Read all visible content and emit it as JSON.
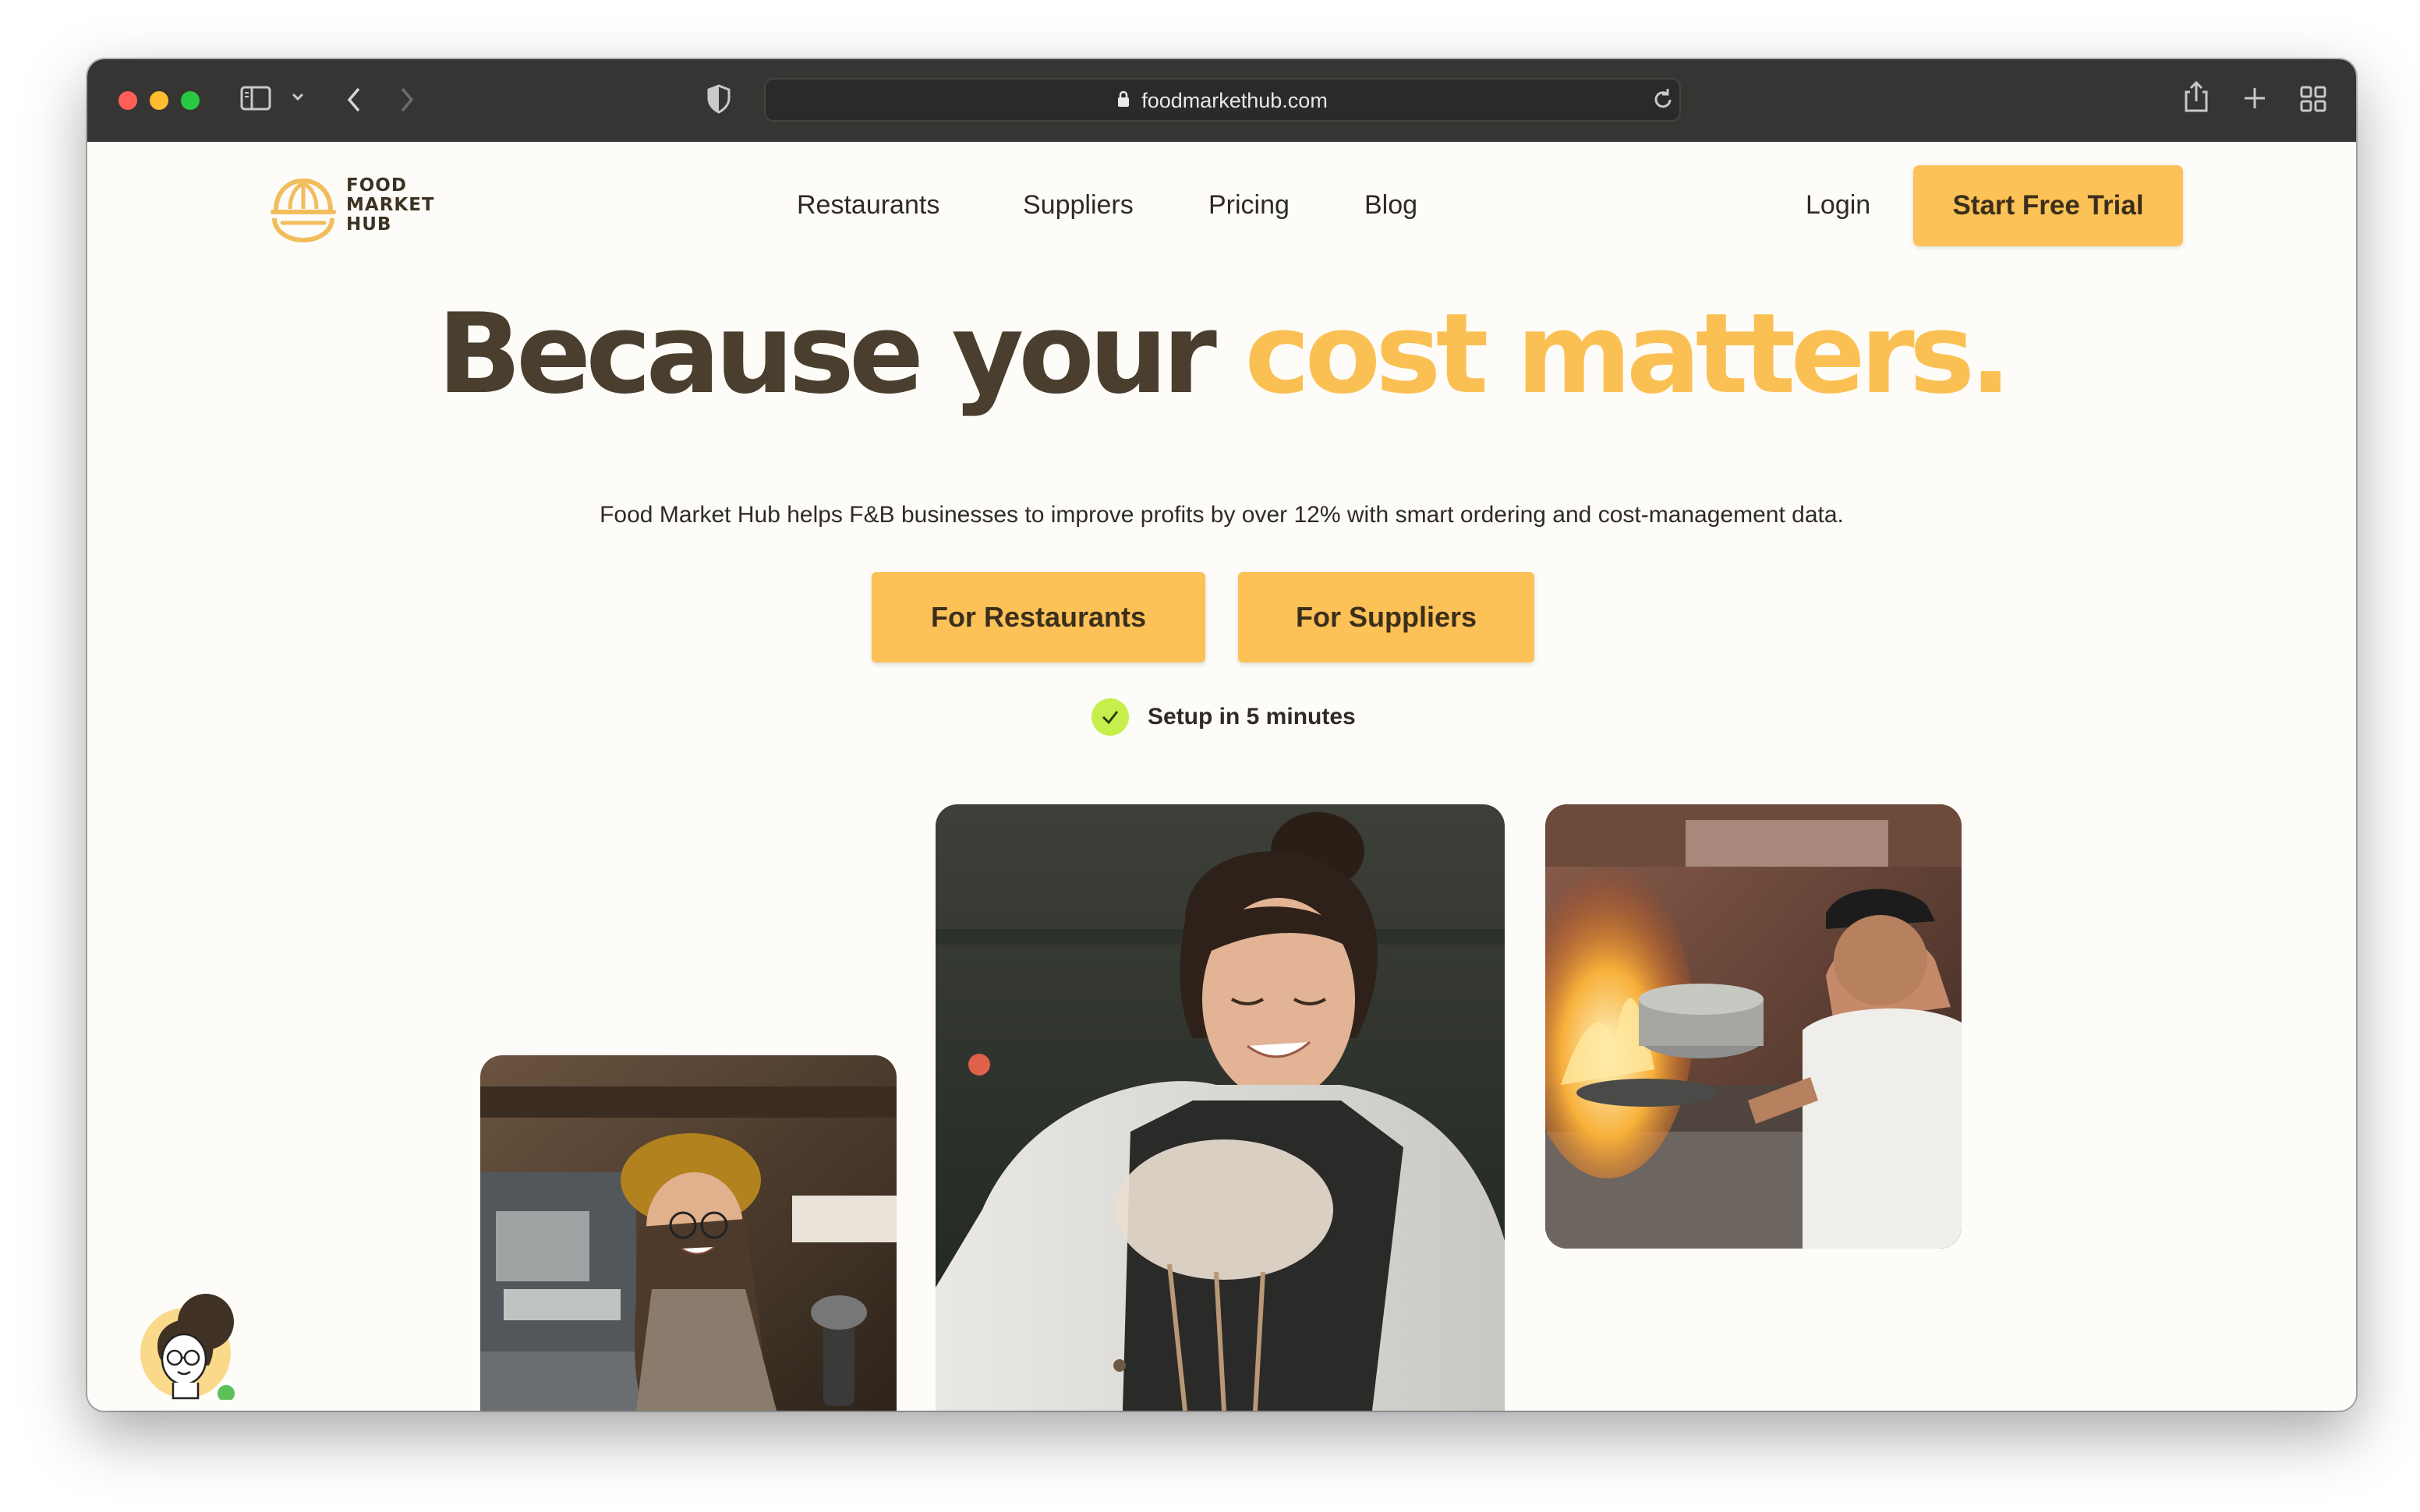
{
  "browser": {
    "url": "foodmarkethub.com"
  },
  "brand": {
    "logo_line1": "FOOD",
    "logo_line2": "MARKET",
    "logo_line3": "HUB",
    "accent_color": "#fcc157",
    "dark_text_color": "#4a3f2e"
  },
  "nav": {
    "items": [
      {
        "label": "Restaurants"
      },
      {
        "label": "Suppliers"
      },
      {
        "label": "Pricing"
      },
      {
        "label": "Blog"
      }
    ],
    "login_label": "Login",
    "cta_label": "Start Free Trial"
  },
  "hero": {
    "headline_part1": "Because your ",
    "headline_accent": "cost matters.",
    "subhead": "Food Market Hub helps F&B businesses to improve profits by over 12% with smart ordering and cost-management data.",
    "button_restaurants": "For Restaurants",
    "button_suppliers": "For Suppliers",
    "setup_note": "Setup in 5 minutes"
  },
  "icons": {
    "back": "chevron-left-icon",
    "forward": "chevron-right-icon",
    "sidebar": "sidebar-icon",
    "shield": "shield-icon",
    "lock": "lock-icon",
    "reload": "reload-icon",
    "share": "share-icon",
    "new_tab": "plus-icon",
    "tabs": "tab-overview-icon",
    "check": "check-icon"
  }
}
